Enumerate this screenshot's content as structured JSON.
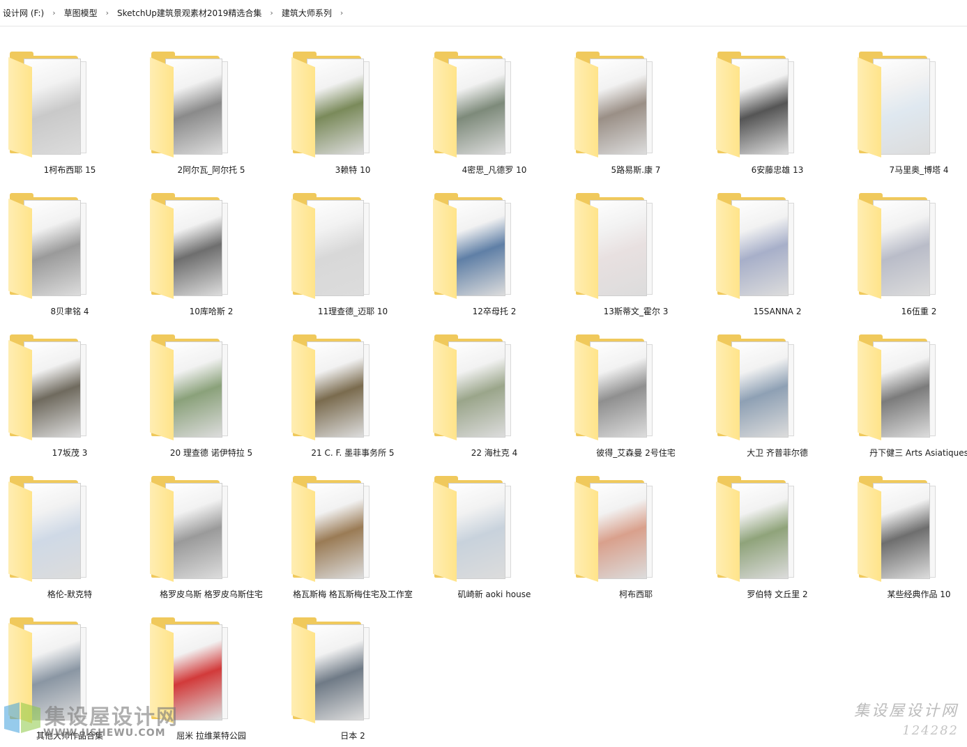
{
  "breadcrumb": [
    "设计网 (F:)",
    "草图模型",
    "SketchUp建筑景观素材2019精选合集",
    "建筑大师系列"
  ],
  "folders": [
    {
      "label": "1柯布西耶 15",
      "thumb": "#c9c9c9"
    },
    {
      "label": "2阿尔瓦_阿尔托 5",
      "thumb": "#8a8a8a"
    },
    {
      "label": "3赖特 10",
      "thumb": "#7a8a5a"
    },
    {
      "label": "4密思_凡德罗 10",
      "thumb": "#7d8a7a"
    },
    {
      "label": "5路易斯.康 7",
      "thumb": "#9a8f86"
    },
    {
      "label": "6安藤忠雄 13",
      "thumb": "#555555"
    },
    {
      "label": "7马里奥_博塔 4",
      "thumb": "#dfe8f0"
    },
    {
      "label": "8贝聿铭 4",
      "thumb": "#9a9a9a"
    },
    {
      "label": "10库哈斯 2",
      "thumb": "#6e6e6e"
    },
    {
      "label": "11理查德_迈耶 10",
      "thumb": "#d8d8d8"
    },
    {
      "label": "12卒母托 2",
      "thumb": "#5f7fa6"
    },
    {
      "label": "13斯蒂文_霍尔 3",
      "thumb": "#e8e0e0"
    },
    {
      "label": "15SANNA 2",
      "thumb": "#a7afc9"
    },
    {
      "label": "16伍重 2",
      "thumb": "#b9bcc8"
    },
    {
      "label": "17坂茂 3",
      "thumb": "#6f6a5e"
    },
    {
      "label": "20 理查德 诺伊特拉 5",
      "thumb": "#8aa17a"
    },
    {
      "label": "21 C. F. 墨菲事务所 5",
      "thumb": "#7a6b4e"
    },
    {
      "label": "22 海杜克 4",
      "thumb": "#9aa58a"
    },
    {
      "label": "彼得_艾森曼 2号住宅",
      "thumb": "#8f8f8f"
    },
    {
      "label": "大卫 齐普菲尔德",
      "thumb": "#8ea0b4"
    },
    {
      "label": "丹下健三 Arts Asiatiques",
      "thumb": "#7b7b7b"
    },
    {
      "label": "格伦-默克特",
      "thumb": "#cfd9e6"
    },
    {
      "label": "格罗皮乌斯 格罗皮乌斯住宅",
      "thumb": "#9a9a9a"
    },
    {
      "label": "格瓦斯梅 格瓦斯梅住宅及工作室",
      "thumb": "#9a7b55"
    },
    {
      "label": "矶崎新 aoki house",
      "thumb": "#c8d2dc"
    },
    {
      "label": "柯布西耶",
      "thumb": "#d9a08c"
    },
    {
      "label": "罗伯特 文丘里 2",
      "thumb": "#8fa37a"
    },
    {
      "label": "某些经典作品 10",
      "thumb": "#6e6e6e"
    },
    {
      "label": "其他大师作品合集",
      "thumb": "#8a96a3"
    },
    {
      "label": "屈米 拉维莱特公园",
      "thumb": "#d23a3a"
    },
    {
      "label": "日本 2",
      "thumb": "#6f7a86"
    }
  ],
  "watermark": {
    "title": "集设屋设计网",
    "id": "124282"
  },
  "logo": {
    "name": "集设屋设计网",
    "url": "WWW.JISHEWU.COM"
  },
  "colors": {
    "folder_back": "#f0c95c",
    "folder_front": "#ffe48a"
  }
}
